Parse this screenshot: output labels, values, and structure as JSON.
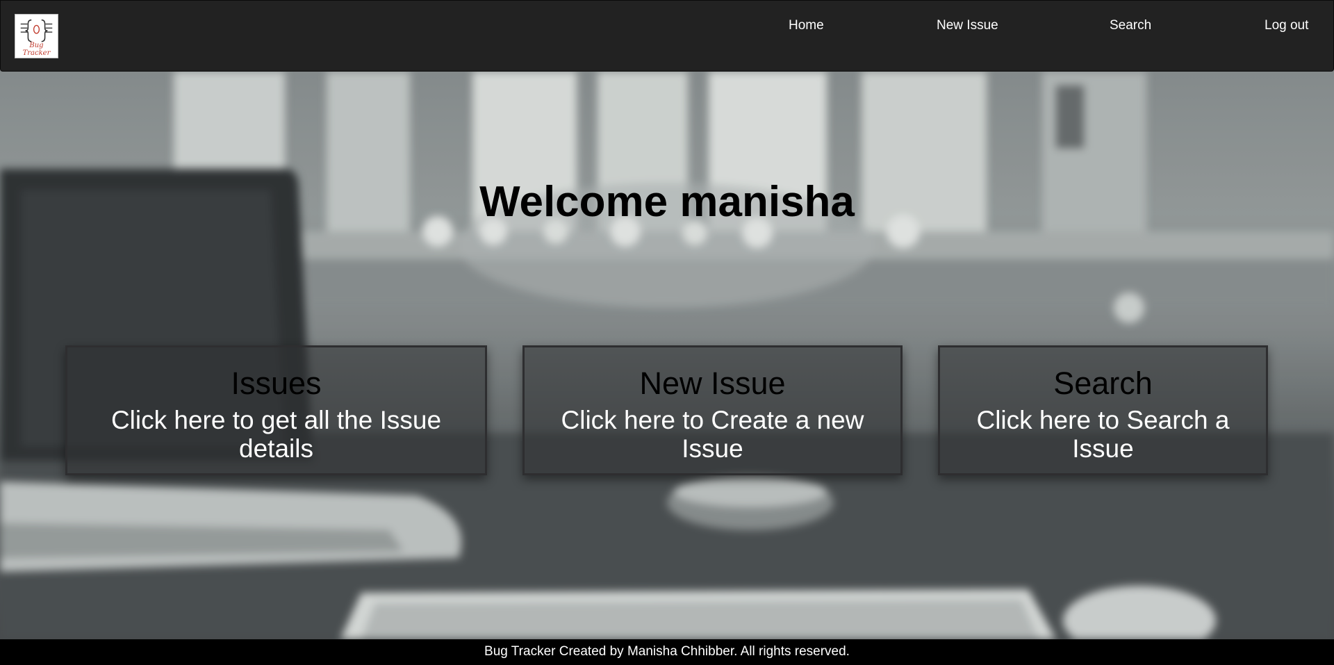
{
  "app": {
    "logo_text": "Bug Tracker"
  },
  "nav": {
    "home": "Home",
    "new_issue": "New Issue",
    "search": "Search",
    "logout": "Log out"
  },
  "hero": {
    "welcome": "Welcome manisha"
  },
  "cards": [
    {
      "title": "Issues",
      "description": "Click here to get all the Issue details"
    },
    {
      "title": "New Issue",
      "description": "Click here to Create a new Issue"
    },
    {
      "title": "Search",
      "description": "Click here to Search a Issue"
    }
  ],
  "footer": {
    "text": "Bug Tracker Created by Manisha Chhibber. All rights reserved."
  },
  "colors": {
    "navbar": "#222222",
    "footer": "#000000",
    "logo_accent": "#c0392b"
  }
}
